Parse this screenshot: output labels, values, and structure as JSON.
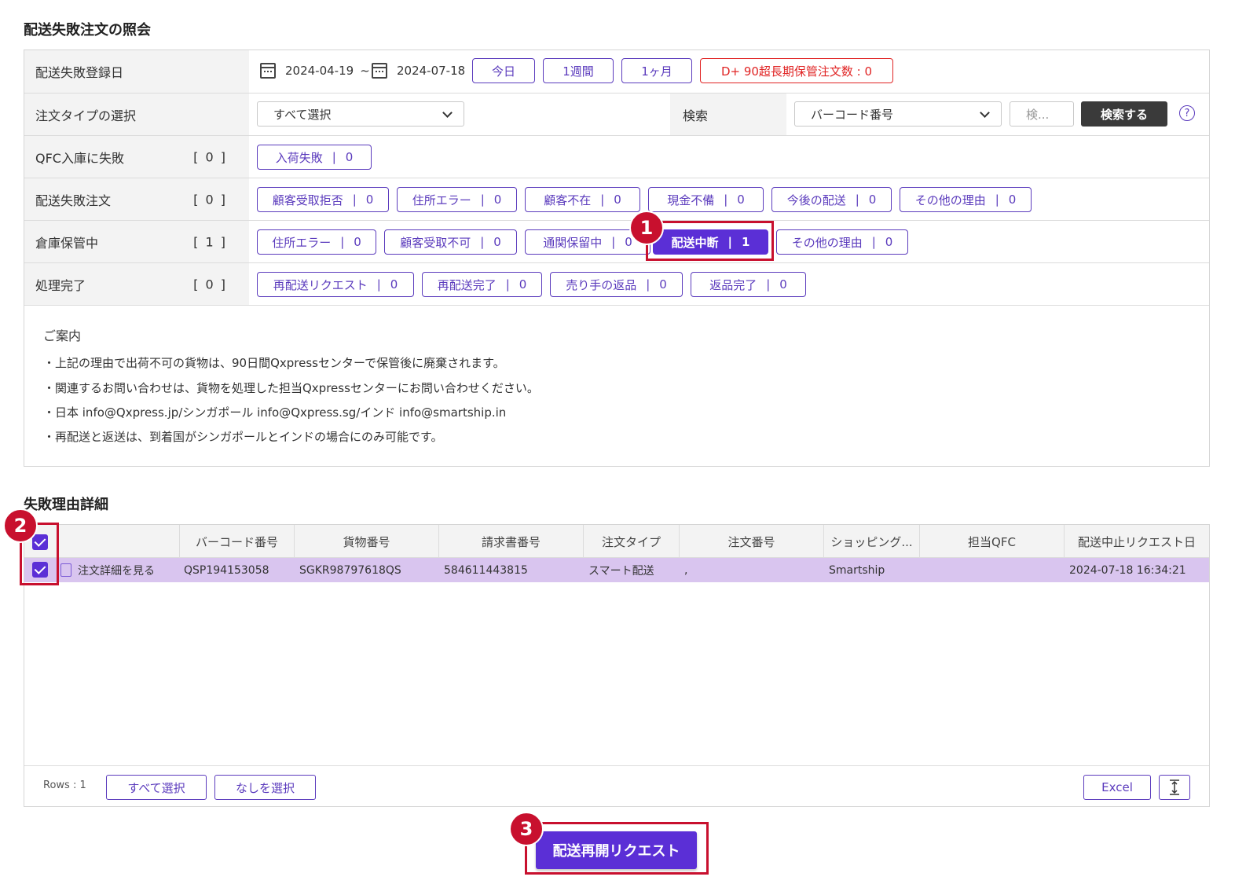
{
  "page": {
    "title": "配送失敗注文の照会",
    "detail_title": "失敗理由詳細"
  },
  "filters": {
    "date_row": {
      "label": "配送失敗登録日",
      "start": "2024-04-19",
      "tilde": "~",
      "end": "2024-07-18",
      "buttons": [
        "今日",
        "1週間",
        "1ヶ月"
      ],
      "long_storage": "D+ 90超長期保管注文数 : 0"
    },
    "type_row": {
      "label": "注文タイプの選択",
      "type_select": "すべて選択",
      "search_label": "検索",
      "search_select": "バーコード番号",
      "search_placeholder": "検...",
      "search_button": "検索する",
      "help": "?"
    },
    "qfc_row": {
      "label": "QFC入庫に失敗",
      "count": "[ 0 ]",
      "chips": [
        {
          "label": "入荷失敗",
          "count": "0"
        }
      ]
    },
    "failed_row": {
      "label": "配送失敗注文",
      "count": "[ 0 ]",
      "chips": [
        {
          "label": "顧客受取拒否",
          "count": "0"
        },
        {
          "label": "住所エラー",
          "count": "0"
        },
        {
          "label": "顧客不在",
          "count": "0"
        },
        {
          "label": "現金不備",
          "count": "0"
        },
        {
          "label": "今後の配送",
          "count": "0"
        },
        {
          "label": "その他の理由",
          "count": "0"
        }
      ]
    },
    "warehouse_row": {
      "label": "倉庫保管中",
      "count": "[ 1 ]",
      "chips": [
        {
          "label": "住所エラー",
          "count": "0"
        },
        {
          "label": "顧客受取不可",
          "count": "0"
        },
        {
          "label": "通関保留中",
          "count": "0"
        },
        {
          "label": "配送中断",
          "count": "1"
        },
        {
          "label": "その他の理由",
          "count": "0"
        }
      ]
    },
    "done_row": {
      "label": "処理完了",
      "count": "[ 0 ]",
      "chips": [
        {
          "label": "再配送リクエスト",
          "count": "0"
        },
        {
          "label": "再配送完了",
          "count": "0"
        },
        {
          "label": "売り手の返品",
          "count": "0"
        },
        {
          "label": "返品完了",
          "count": "0"
        }
      ]
    }
  },
  "notice": {
    "title": "ご案内",
    "lines": [
      "・上記の理由で出荷不可の貨物は、90日間Qxpressセンターで保管後に廃棄されます。",
      "・関連するお問い合わせは、貨物を処理した担当Qxpressセンターにお問い合わせください。",
      "・日本 info@Qxpress.jp/シンガポール info@Qxpress.sg/インド info@smartship.in",
      "・再配送と返送は、到着国がシンガポールとインドの場合にのみ可能です。"
    ]
  },
  "table": {
    "headers": [
      "バーコード番号",
      "貨物番号",
      "請求書番号",
      "注文タイプ",
      "注文番号",
      "ショッピング...",
      "担当QFC",
      "配送中止リクエスト日"
    ],
    "rows": [
      {
        "link": "注文詳細を見る",
        "barcode": "QSP194153058",
        "cargo": "SGKR98797618QS",
        "invoice": "584611443815",
        "type": "スマート配送",
        "order": ",",
        "shopping": "Smartship",
        "qfc": "",
        "date": "2024-07-18 16:34:21"
      }
    ],
    "rows_label": "Rows : 1",
    "select_all": "すべて選択",
    "select_none": "なしを選択",
    "excel": "Excel"
  },
  "action": {
    "resume_button": "配送再開リクエスト"
  },
  "annotations": [
    "1",
    "2",
    "3"
  ],
  "colors": {
    "accent": "#5b2fd6",
    "highlight": "#c8102e",
    "row_selected": "#d9c5ef"
  }
}
